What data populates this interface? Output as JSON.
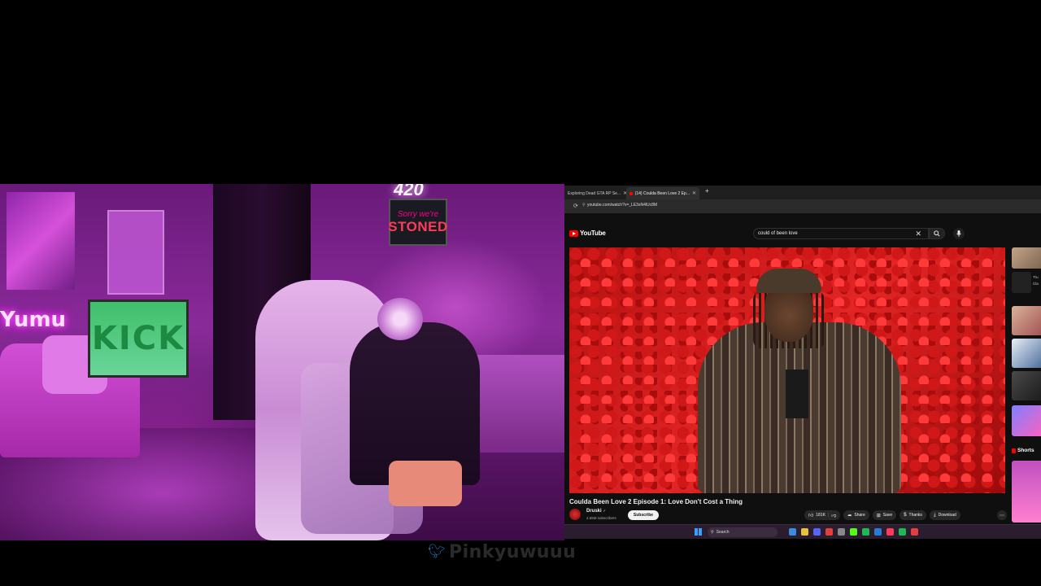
{
  "webcam": {
    "neon_sign_left": "Yumu",
    "neon_sign_top": "420",
    "stoned_sign_line1": "Sorry we're",
    "stoned_sign_line2": "STONED",
    "kick_sign": "KICK",
    "wall_neon_420": "420"
  },
  "browser": {
    "tabs": [
      {
        "label": "Exploring Dead GTA RP Se...",
        "active": false
      },
      {
        "label": "(14) Coulda Been Love 2 Ep...",
        "active": true
      }
    ],
    "address": "youtube.com/watch?v=_LE3sN4lUc8M",
    "logo_text": "YouTube",
    "search": {
      "value": "could of been love"
    },
    "video": {
      "title": "Coulda Been Love 2 Episode 1: Love Don't Cost a Thing",
      "channel": "Druski",
      "subscribers": "4.65M subscribers",
      "subscribe_label": "Subscribe",
      "likes": "181K",
      "share_label": "Share",
      "save_label": "Save",
      "thanks_label": "Thanks",
      "download_label": "Download"
    },
    "sidebar": {
      "chip1": "Tru",
      "chip2": "Cla",
      "shorts_label": "Shorts"
    },
    "taskbar": {
      "search_label": "Search"
    }
  },
  "overlay": {
    "twitter_handle": "Pinkyuwuuu"
  },
  "colors": {
    "youtube_red": "#ff0000",
    "webcam_purple": "#8a2a9a",
    "twitter_blue": "#1d6fb0"
  }
}
